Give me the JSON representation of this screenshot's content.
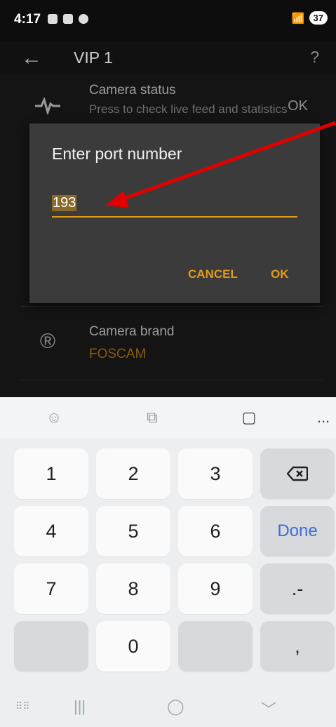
{
  "status": {
    "time": "4:17",
    "battery": "37"
  },
  "appbar": {
    "title": "VIP 1",
    "help": "?",
    "back": "←"
  },
  "rows": {
    "camera_status": {
      "title": "Camera status",
      "subtitle": "Press to check live feed and statistics",
      "value": "OK"
    },
    "camera_brand": {
      "title": "Camera brand",
      "value": "FOSCAM"
    }
  },
  "dialog": {
    "title": "Enter port number",
    "value": "193",
    "cancel": "CANCEL",
    "ok": "OK"
  },
  "keyboard": {
    "toolbar_more": "...",
    "keys": {
      "k1": "1",
      "k2": "2",
      "k3": "3",
      "k4": "4",
      "k5": "5",
      "k6": "6",
      "k7": "7",
      "k8": "8",
      "k9": "9",
      "k0": "0",
      "done": "Done",
      "dotdash": ".-",
      "comma": ","
    }
  },
  "colors": {
    "accent": "#e39a1a",
    "done": "#3b6fd0",
    "arrow": "#e00000"
  }
}
